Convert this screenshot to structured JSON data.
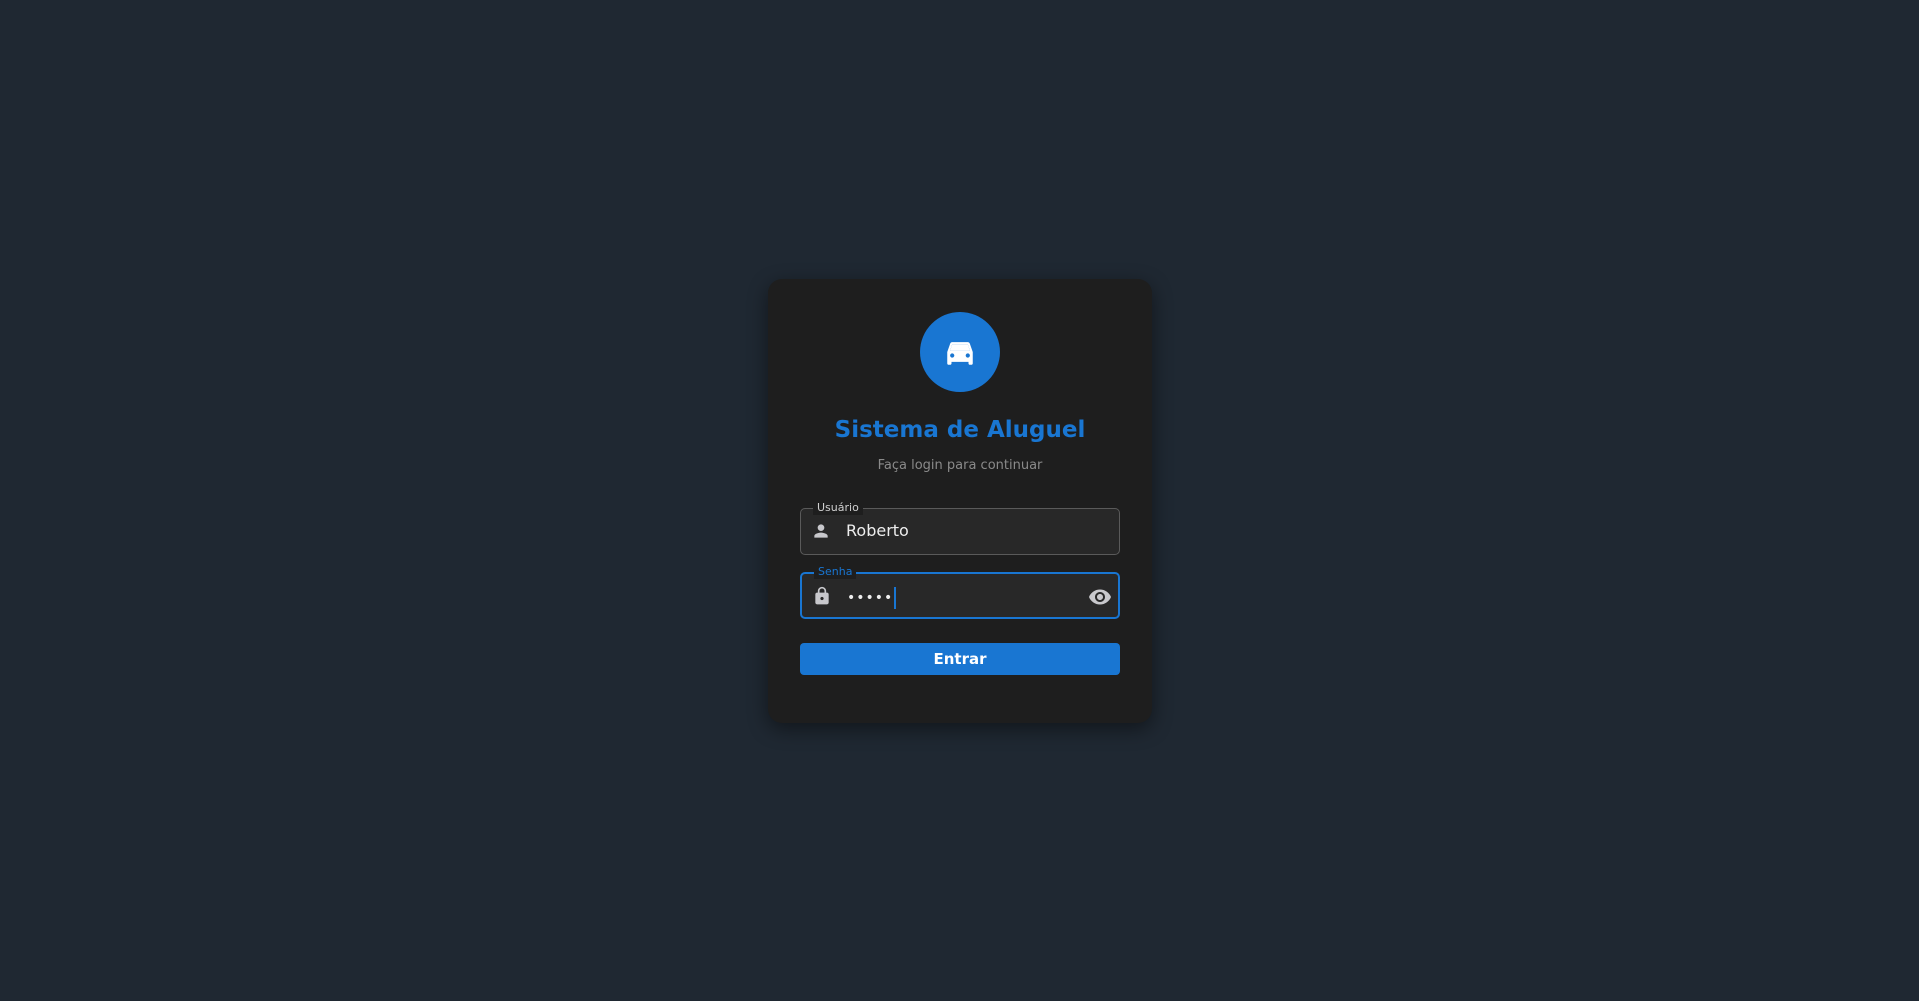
{
  "app": {
    "title": "Sistema de Aluguel",
    "subtitle": "Faça login para continuar"
  },
  "form": {
    "username": {
      "label": "Usuário",
      "value": "Roberto",
      "icon": "person-icon"
    },
    "password": {
      "label": "Senha",
      "value": "•••••",
      "icon": "lock-icon",
      "toggle_icon": "eye-icon"
    },
    "submit_label": "Entrar"
  },
  "colors": {
    "accent": "#1976d2",
    "background": "#1f2832",
    "card": "#1e1e1e"
  }
}
